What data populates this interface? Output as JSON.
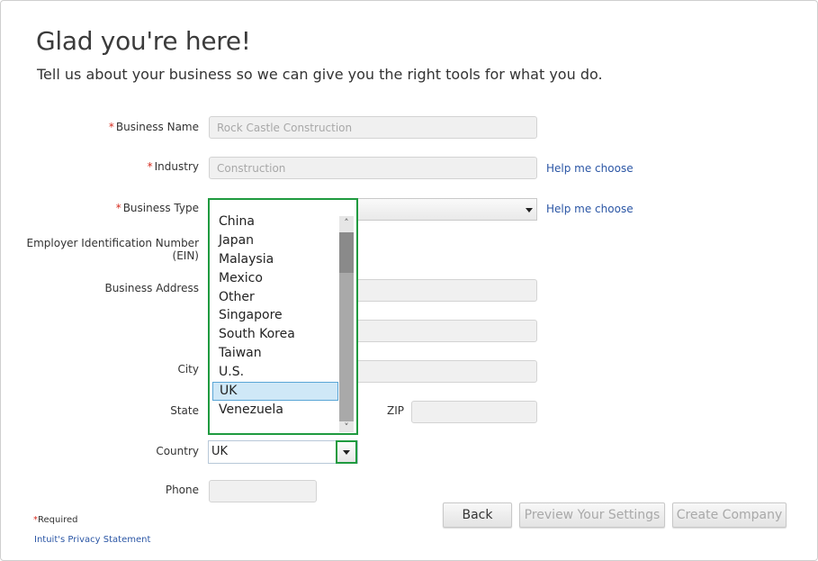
{
  "header": {
    "title": "Glad you're here!",
    "subtitle": "Tell us about your business so we can give you the right tools for what you do."
  },
  "form": {
    "business_name": {
      "label": "Business Name",
      "value": "Rock Castle Construction",
      "required": true
    },
    "industry": {
      "label": "Industry",
      "value": "Construction",
      "required": true,
      "help": "Help me choose"
    },
    "business_type": {
      "label": "Business Type",
      "value": "",
      "required": true,
      "help": "Help me choose"
    },
    "ein": {
      "label_line1": "Employer Identification Number",
      "label_line2": "(EIN)"
    },
    "address": {
      "label": "Business Address"
    },
    "city": {
      "label": "City"
    },
    "state": {
      "label": "State"
    },
    "zip": {
      "label": "ZIP"
    },
    "country": {
      "label": "Country",
      "value": "UK"
    },
    "phone": {
      "label": "Phone"
    }
  },
  "country_dropdown": {
    "options": [
      "China",
      "Japan",
      "Malaysia",
      "Mexico",
      "Other",
      "Singapore",
      "South Korea",
      "Taiwan",
      "U.S.",
      "UK",
      "Venezuela"
    ],
    "selected": "UK"
  },
  "buttons": {
    "back": "Back",
    "preview": "Preview Your Settings",
    "create": "Create Company"
  },
  "footer": {
    "required_mark": "*",
    "required_text": "Required",
    "privacy": "Intuit's Privacy Statement"
  },
  "colors": {
    "focus_outline": "#1f9a3f",
    "required_star": "#d52b1e",
    "link": "#2b56a5",
    "selected_option": "#cfe8f7"
  },
  "icons": {
    "dropdown_caret": "chevron-down-icon",
    "scroll_up": "chevron-up-icon",
    "scroll_down": "chevron-down-icon"
  }
}
